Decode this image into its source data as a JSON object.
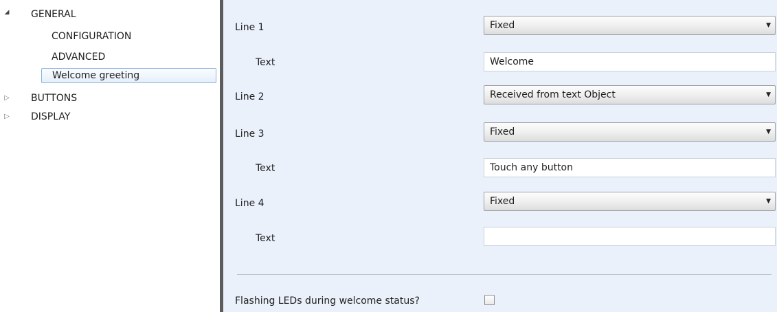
{
  "tree": {
    "general": {
      "label": "GENERAL",
      "expander_icon": "triangle-expanded-icon"
    },
    "configuration": {
      "label": "CONFIGURATION"
    },
    "advanced": {
      "label": "ADVANCED"
    },
    "welcome_greeting": {
      "label": "Welcome greeting"
    },
    "buttons": {
      "label": "BUTTONS",
      "expander_icon": "triangle-collapsed-icon"
    },
    "display": {
      "label": "DISPLAY",
      "expander_icon": "triangle-collapsed-icon"
    }
  },
  "params": {
    "line1": {
      "label": "Line 1",
      "value": "Fixed"
    },
    "line1_text": {
      "label": "Text",
      "value": "Welcome"
    },
    "line2": {
      "label": "Line 2",
      "value": "Received from text Object"
    },
    "line3": {
      "label": "Line 3",
      "value": "Fixed"
    },
    "line3_text": {
      "label": "Text",
      "value": "Touch any button"
    },
    "line4": {
      "label": "Line 4",
      "value": "Fixed"
    },
    "line4_text": {
      "label": "Text",
      "value": ""
    },
    "flashing_leds": {
      "label": "Flashing LEDs during welcome status?",
      "checked": false
    }
  },
  "colors": {
    "panel_background": "#eaf1fa",
    "selection_border": "#8bb3dd",
    "divider": "#5c5c5c"
  }
}
